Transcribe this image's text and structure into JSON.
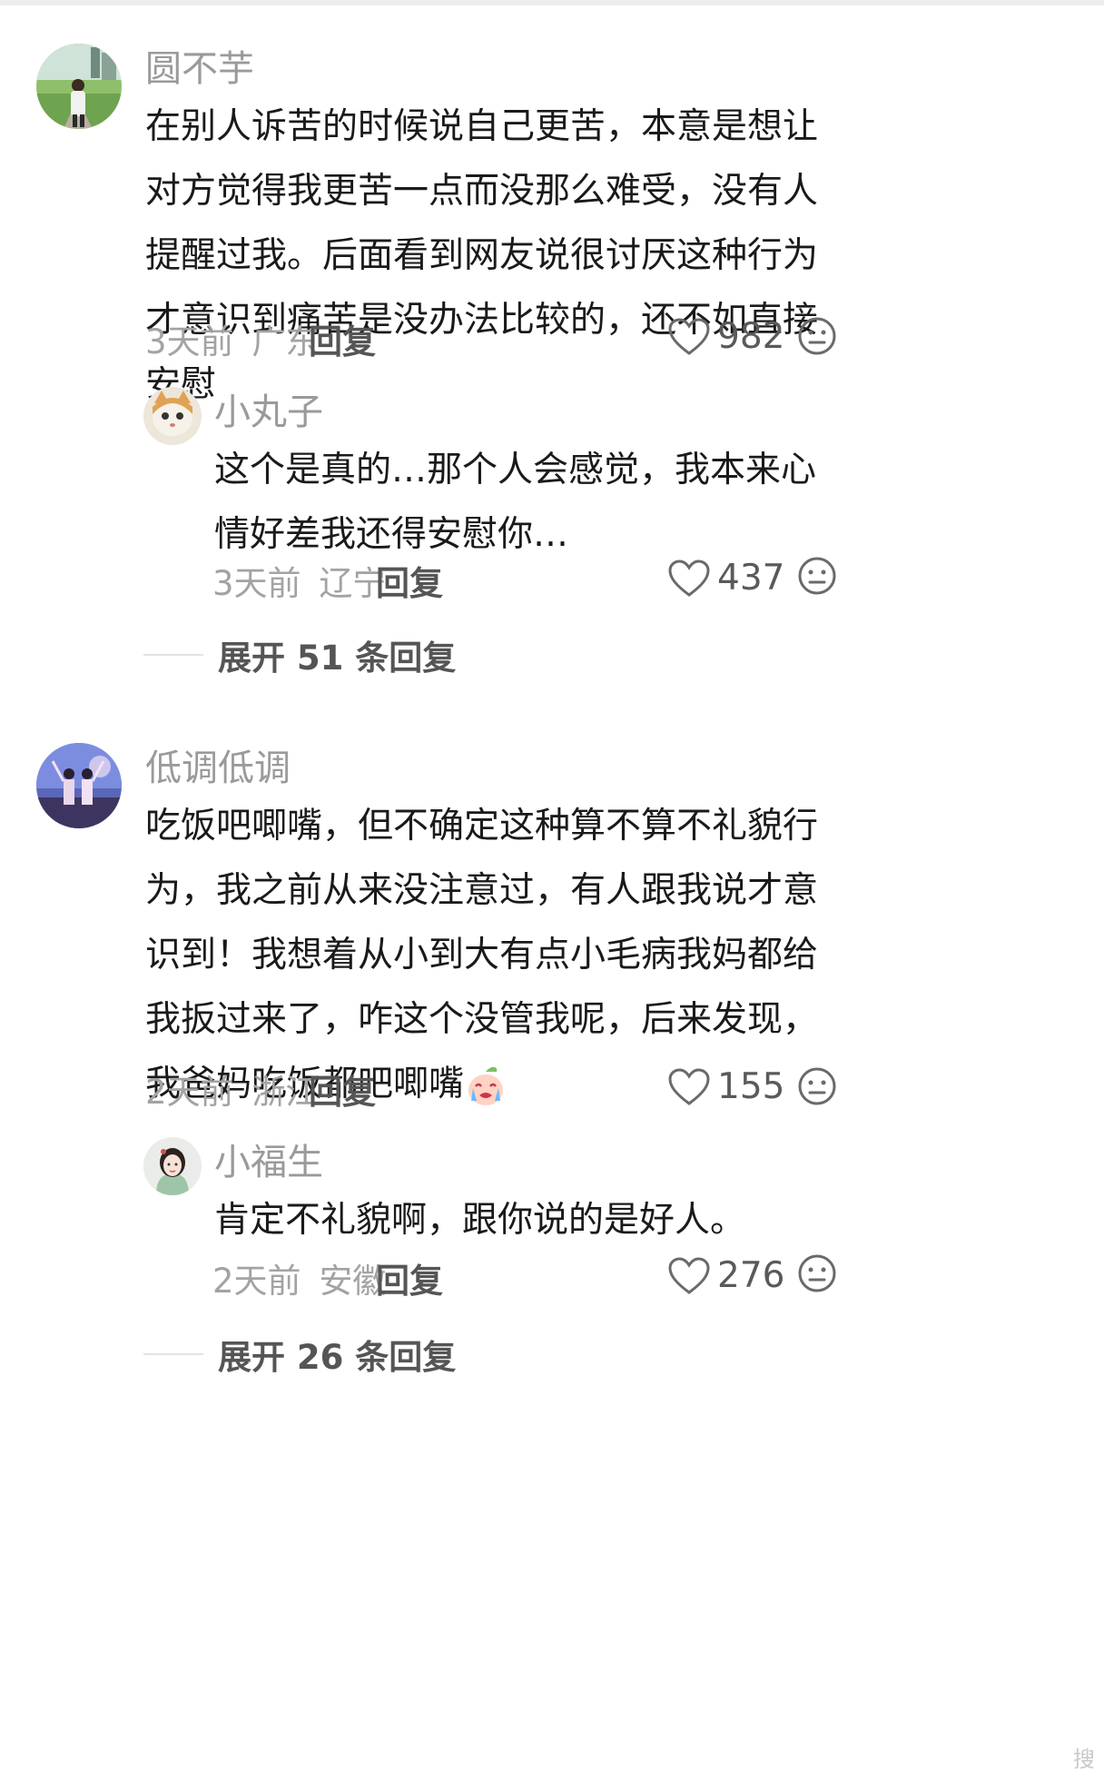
{
  "comments": [
    {
      "username": "圆不芋",
      "text": "在别人诉苦的时候说自己更苦，本意是想让对方觉得我更苦一点而没那么难受，没有人提醒过我。后面看到网友说很讨厌这种行为才意识到痛苦是没办法比较的，还不如直接安慰",
      "time": "3天前",
      "location": "广东",
      "reply_label": "回复",
      "likes": "982",
      "avatar_icon": "avatar-girl-park-icon",
      "replies": [
        {
          "username": "小丸子",
          "text": "这个是真的…那个人会感觉，我本来心情好差我还得安慰你…",
          "time": "3天前",
          "location": "辽宁",
          "reply_label": "回复",
          "likes": "437",
          "avatar_icon": "avatar-cat-icon"
        }
      ],
      "expand_label": "展开 51 条回复"
    },
    {
      "username": "低调低调",
      "text": "吃饭吧唧嘴，但不确定这种算不算不礼貌行为，我之前从来没注意过，有人跟我说才意识到！我想着从小到大有点小毛病我妈都给我扳过来了，咋这个没管我呢，后来发现，我爸妈吃饭都吧唧嘴",
      "emoji_icon": "crying-peach-emoji-icon",
      "time": "2天前",
      "location": "浙江",
      "reply_label": "回复",
      "likes": "155",
      "avatar_icon": "avatar-two-girls-icon",
      "replies": [
        {
          "username": "小福生",
          "text": "肯定不礼貌啊，跟你说的是好人。",
          "time": "2天前",
          "location": "安徽",
          "reply_label": "回复",
          "likes": "276",
          "avatar_icon": "avatar-woman-portrait-icon"
        }
      ],
      "expand_label": "展开 26 条回复"
    }
  ],
  "watermark": "搜"
}
